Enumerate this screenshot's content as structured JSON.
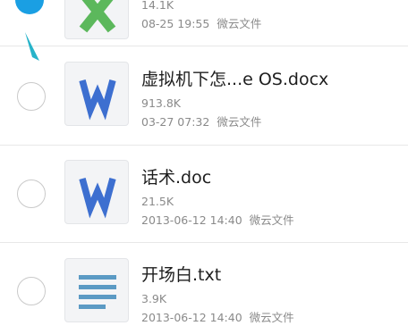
{
  "file_list": {
    "items": [
      {
        "name": "",
        "size": "14.1K",
        "date": "08-25 19:55",
        "source": "微云文件",
        "icon": "excel-icon",
        "selected": true
      },
      {
        "name": "虚拟机下怎...e OS.docx",
        "size": "913.8K",
        "date": "03-27 07:32",
        "source": "微云文件",
        "icon": "wps-word-icon",
        "selected": false
      },
      {
        "name": "话术.doc",
        "size": "21.5K",
        "date": "2013-06-12 14:40",
        "source": "微云文件",
        "icon": "wps-word-icon",
        "selected": false
      },
      {
        "name": "开场白.txt",
        "size": "3.9K",
        "date": "2013-06-12 14:40",
        "source": "微云文件",
        "icon": "text-file-icon",
        "selected": false
      }
    ]
  },
  "colors": {
    "accent": "#1a9fe3",
    "wps_blue": "#3d6fd0",
    "excel_green": "#5cb85c",
    "text_lines": "#5b9ac4"
  }
}
